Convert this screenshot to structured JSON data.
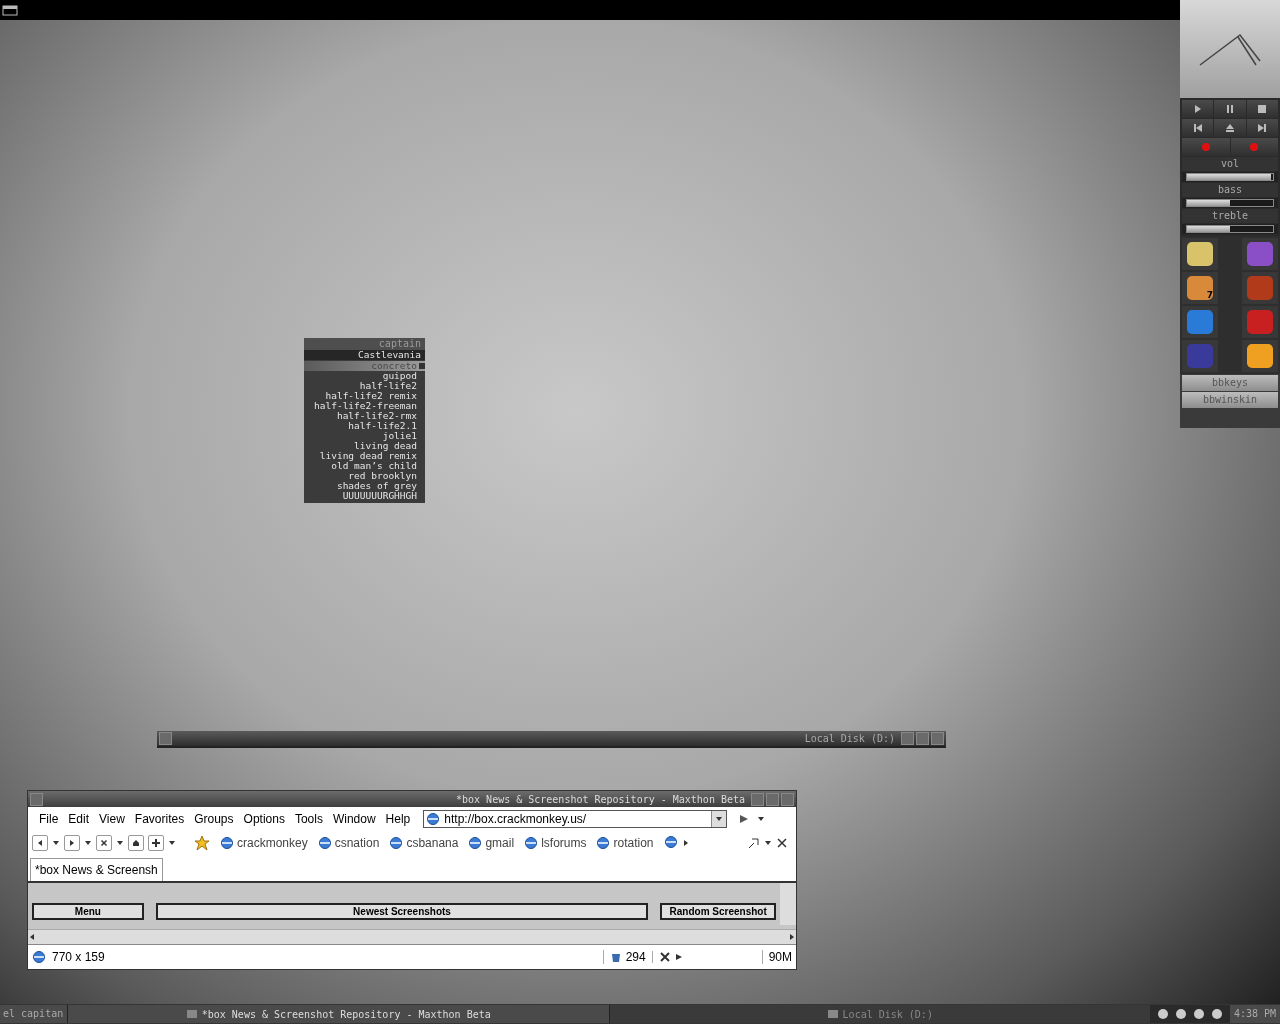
{
  "slit": {
    "sliders": [
      {
        "label": "vol",
        "level": 0.98
      },
      {
        "label": "bass",
        "level": 0.5
      },
      {
        "label": "treble",
        "level": 0.5
      }
    ],
    "launcher_badge": "7",
    "dockapps": [
      "bbkeys",
      "bbwinskin"
    ]
  },
  "menu": {
    "title": "captain",
    "items": [
      {
        "label": "Castlevania",
        "kind": "heading",
        "selected": false,
        "checked": false
      },
      {
        "label": "concreto",
        "kind": "item",
        "selected": true,
        "checked": true
      },
      {
        "label": "guipod",
        "kind": "item",
        "selected": false,
        "checked": false
      },
      {
        "label": "half-life2",
        "kind": "item",
        "selected": false,
        "checked": false
      },
      {
        "label": "half-life2 remix",
        "kind": "item",
        "selected": false,
        "checked": false
      },
      {
        "label": "half-life2-freeman",
        "kind": "item",
        "selected": false,
        "checked": false
      },
      {
        "label": "half-life2-rmx",
        "kind": "item",
        "selected": false,
        "checked": false
      },
      {
        "label": "half-life2.1",
        "kind": "item",
        "selected": false,
        "checked": false
      },
      {
        "label": "jolie1",
        "kind": "item",
        "selected": false,
        "checked": false
      },
      {
        "label": "living dead",
        "kind": "item",
        "selected": false,
        "checked": false
      },
      {
        "label": "living dead remix",
        "kind": "item",
        "selected": false,
        "checked": false
      },
      {
        "label": "old man’s child",
        "kind": "item",
        "selected": false,
        "checked": false
      },
      {
        "label": "red brooklyn",
        "kind": "item",
        "selected": false,
        "checked": false
      },
      {
        "label": "shades of grey",
        "kind": "item",
        "selected": false,
        "checked": false
      },
      {
        "label": "UUUUUUURGHHGH",
        "kind": "item",
        "selected": false,
        "checked": false
      }
    ]
  },
  "shaded_window": {
    "title": "Local Disk (D:)"
  },
  "browser": {
    "title": "*box News & Screenshot Repository - Maxthon Beta",
    "menus": [
      "File",
      "Edit",
      "View",
      "Favorites",
      "Groups",
      "Options",
      "Tools",
      "Window",
      "Help"
    ],
    "address": "http://box.crackmonkey.us/",
    "links": [
      "crackmonkey",
      "csnation",
      "csbanana",
      "gmail",
      "lsforums",
      "rotation"
    ],
    "tab": "*box News & Screensh",
    "page_buttons": [
      "Menu",
      "Newest Screenshots",
      "Random Screenshot"
    ],
    "status": {
      "size": "770 x 159",
      "count": "294",
      "memory": "90M"
    }
  },
  "taskbar": {
    "workspace": "el capitan",
    "tasks": [
      {
        "label": "*box News & Screenshot Repository - Maxthon Beta",
        "selected": true
      },
      {
        "label": "Local Disk (D:)",
        "selected": false
      }
    ],
    "clock": "4:38 PM"
  }
}
